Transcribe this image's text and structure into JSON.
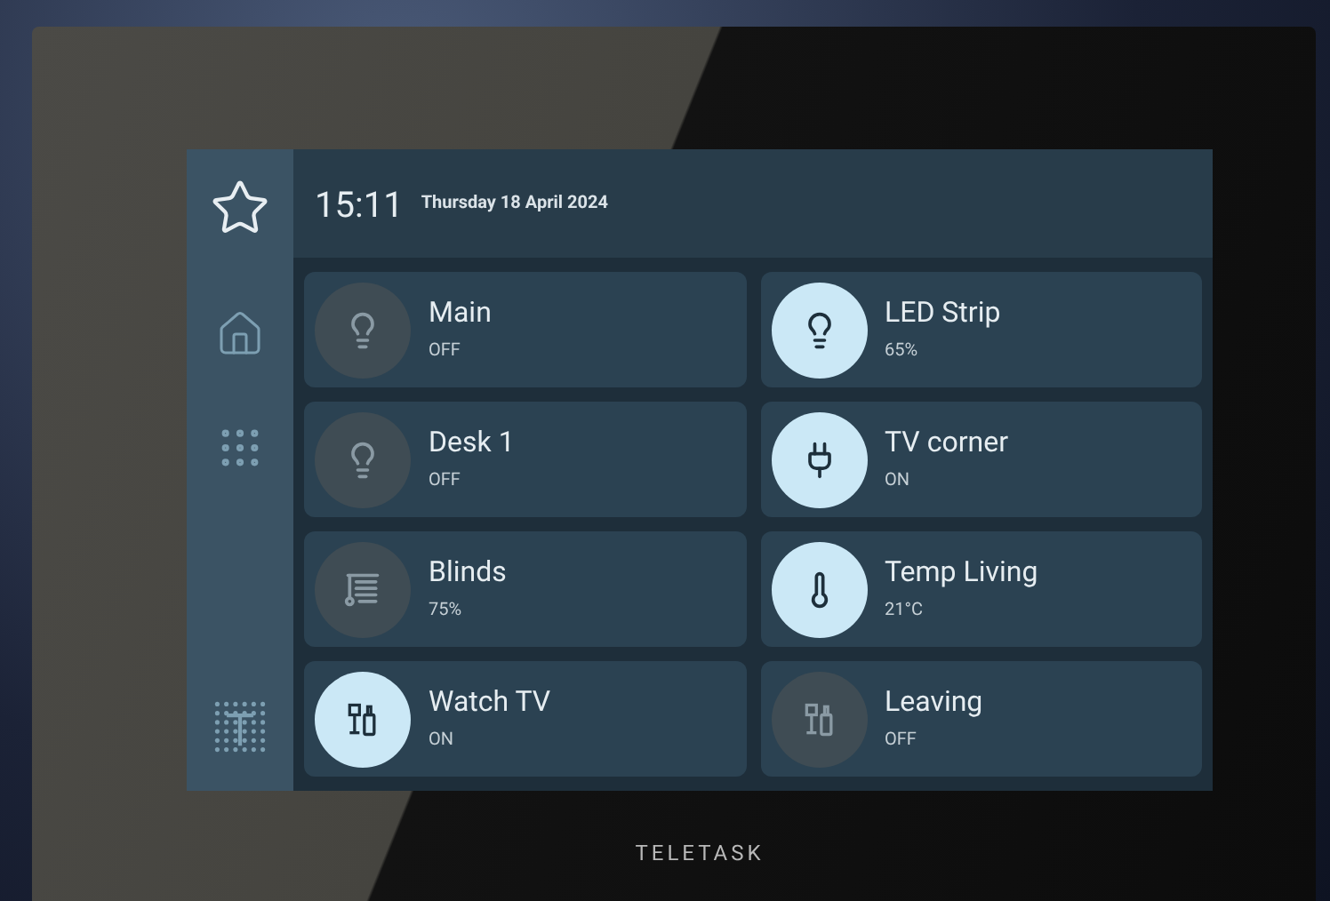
{
  "header": {
    "time": "15:11",
    "date": "Thursday 18 April 2024"
  },
  "tiles": [
    {
      "kind": "light",
      "name": "Main",
      "status": "OFF",
      "on": false
    },
    {
      "kind": "light",
      "name": "LED Strip",
      "status": "65%",
      "on": true
    },
    {
      "kind": "light",
      "name": "Desk 1",
      "status": "OFF",
      "on": false
    },
    {
      "kind": "plug",
      "name": "TV corner",
      "status": "ON",
      "on": true
    },
    {
      "kind": "blinds",
      "name": "Blinds",
      "status": "75%",
      "on": false
    },
    {
      "kind": "thermostat",
      "name": "Temp Living",
      "status": "21°C",
      "on": true
    },
    {
      "kind": "scene",
      "name": "Watch TV",
      "status": "ON",
      "on": true
    },
    {
      "kind": "scene",
      "name": "Leaving",
      "status": "OFF",
      "on": false
    }
  ],
  "brand": "TELETASK"
}
